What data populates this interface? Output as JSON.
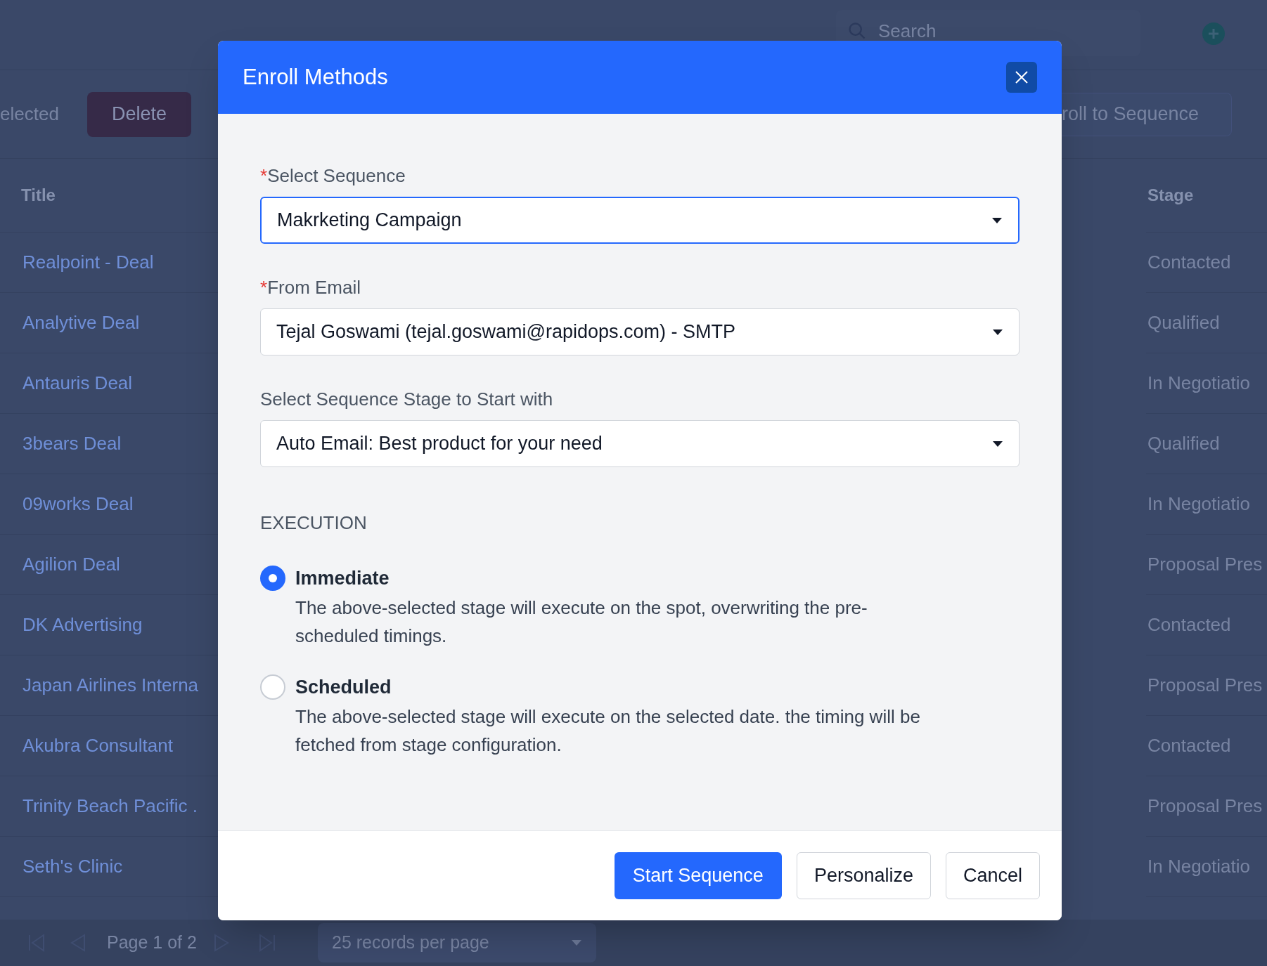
{
  "page": {
    "search": {
      "placeholder": "Search"
    },
    "toolbar": {
      "selection_text": "elected",
      "delete_button": "Delete",
      "enroll_button": "roll to Sequence"
    },
    "table": {
      "columns": [
        "Title",
        "Stage"
      ],
      "rows": [
        {
          "title": "Realpoint - Deal",
          "stage": "Contacted"
        },
        {
          "title": "Analytive Deal",
          "stage": "Qualified"
        },
        {
          "title": "Antauris Deal",
          "stage": "In Negotiatio"
        },
        {
          "title": "3bears Deal",
          "stage": "Qualified"
        },
        {
          "title": "09works Deal",
          "stage": "In Negotiatio"
        },
        {
          "title": "Agilion Deal",
          "stage": "Proposal Pres"
        },
        {
          "title": "DK Advertising",
          "stage": "Contacted"
        },
        {
          "title": "Japan Airlines Interna",
          "stage": "Proposal Pres"
        },
        {
          "title": "Akubra Consultant",
          "stage": "Contacted"
        },
        {
          "title": "Trinity Beach Pacific .",
          "stage": "Proposal Pres"
        },
        {
          "title": "Seth's Clinic",
          "stage": "In Negotiatio"
        }
      ]
    },
    "pager": {
      "page_text": "Page 1 of 2",
      "per_page": "25 records per page"
    }
  },
  "dialog": {
    "title": "Enroll Methods",
    "fields": [
      {
        "required_mark": "*",
        "label": "Select Sequence",
        "value": "Makrketing Campaign",
        "focused": true
      },
      {
        "required_mark": "*",
        "label": "From Email",
        "value": "Tejal Goswami (tejal.goswami@rapidops.com) - SMTP",
        "focused": false
      },
      {
        "label": "Select Sequence Stage to Start with",
        "value": "Auto Email: Best product for your need",
        "focused": false
      }
    ],
    "execution": {
      "heading": "EXECUTION",
      "options": [
        {
          "label": "Immediate",
          "description": "The above-selected stage will execute on the spot, overwriting the pre-scheduled timings.",
          "selected": true
        },
        {
          "label": "Scheduled",
          "description": "The above-selected stage will execute on the selected date. the timing will be fetched from stage configuration.",
          "selected": false
        }
      ]
    },
    "buttons": [
      {
        "label": "Start Sequence",
        "kind": "primary"
      },
      {
        "label": "Personalize",
        "kind": "secondary"
      },
      {
        "label": "Cancel",
        "kind": "secondary"
      }
    ]
  }
}
